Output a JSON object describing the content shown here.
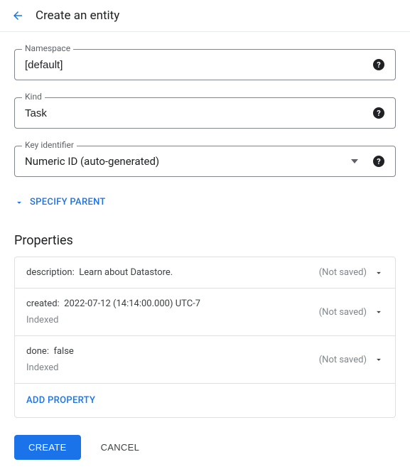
{
  "header": {
    "title": "Create an entity"
  },
  "fields": {
    "namespace": {
      "label": "Namespace",
      "value": "[default]"
    },
    "kind": {
      "label": "Kind",
      "value": "Task"
    },
    "key_identifier": {
      "label": "Key identifier",
      "value": "Numeric ID (auto-generated)"
    }
  },
  "specify_parent": "SPECIFY PARENT",
  "properties_heading": "Properties",
  "not_saved_label": "(Not saved)",
  "indexed_label": "Indexed",
  "properties": [
    {
      "name": "description",
      "value": "Learn about Datastore.",
      "indexed": false
    },
    {
      "name": "created",
      "value": "2022-07-12 (14:14:00.000) UTC-7",
      "indexed": true
    },
    {
      "name": "done",
      "value": "false",
      "indexed": true
    }
  ],
  "add_property": "ADD PROPERTY",
  "actions": {
    "create": "CREATE",
    "cancel": "CANCEL"
  }
}
